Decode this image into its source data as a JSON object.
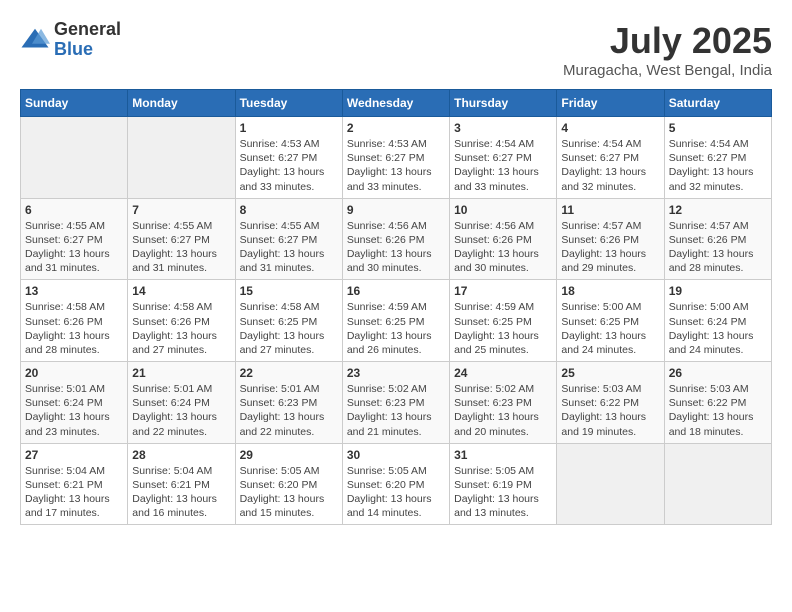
{
  "logo": {
    "general": "General",
    "blue": "Blue"
  },
  "title": {
    "month": "July 2025",
    "location": "Muragacha, West Bengal, India"
  },
  "weekdays": [
    "Sunday",
    "Monday",
    "Tuesday",
    "Wednesday",
    "Thursday",
    "Friday",
    "Saturday"
  ],
  "weeks": [
    [
      {
        "day": "",
        "info": ""
      },
      {
        "day": "",
        "info": ""
      },
      {
        "day": "1",
        "sunrise": "4:53 AM",
        "sunset": "6:27 PM",
        "daylight": "13 hours and 33 minutes."
      },
      {
        "day": "2",
        "sunrise": "4:53 AM",
        "sunset": "6:27 PM",
        "daylight": "13 hours and 33 minutes."
      },
      {
        "day": "3",
        "sunrise": "4:54 AM",
        "sunset": "6:27 PM",
        "daylight": "13 hours and 33 minutes."
      },
      {
        "day": "4",
        "sunrise": "4:54 AM",
        "sunset": "6:27 PM",
        "daylight": "13 hours and 32 minutes."
      },
      {
        "day": "5",
        "sunrise": "4:54 AM",
        "sunset": "6:27 PM",
        "daylight": "13 hours and 32 minutes."
      }
    ],
    [
      {
        "day": "6",
        "sunrise": "4:55 AM",
        "sunset": "6:27 PM",
        "daylight": "13 hours and 31 minutes."
      },
      {
        "day": "7",
        "sunrise": "4:55 AM",
        "sunset": "6:27 PM",
        "daylight": "13 hours and 31 minutes."
      },
      {
        "day": "8",
        "sunrise": "4:55 AM",
        "sunset": "6:27 PM",
        "daylight": "13 hours and 31 minutes."
      },
      {
        "day": "9",
        "sunrise": "4:56 AM",
        "sunset": "6:26 PM",
        "daylight": "13 hours and 30 minutes."
      },
      {
        "day": "10",
        "sunrise": "4:56 AM",
        "sunset": "6:26 PM",
        "daylight": "13 hours and 30 minutes."
      },
      {
        "day": "11",
        "sunrise": "4:57 AM",
        "sunset": "6:26 PM",
        "daylight": "13 hours and 29 minutes."
      },
      {
        "day": "12",
        "sunrise": "4:57 AM",
        "sunset": "6:26 PM",
        "daylight": "13 hours and 28 minutes."
      }
    ],
    [
      {
        "day": "13",
        "sunrise": "4:58 AM",
        "sunset": "6:26 PM",
        "daylight": "13 hours and 28 minutes."
      },
      {
        "day": "14",
        "sunrise": "4:58 AM",
        "sunset": "6:26 PM",
        "daylight": "13 hours and 27 minutes."
      },
      {
        "day": "15",
        "sunrise": "4:58 AM",
        "sunset": "6:25 PM",
        "daylight": "13 hours and 27 minutes."
      },
      {
        "day": "16",
        "sunrise": "4:59 AM",
        "sunset": "6:25 PM",
        "daylight": "13 hours and 26 minutes."
      },
      {
        "day": "17",
        "sunrise": "4:59 AM",
        "sunset": "6:25 PM",
        "daylight": "13 hours and 25 minutes."
      },
      {
        "day": "18",
        "sunrise": "5:00 AM",
        "sunset": "6:25 PM",
        "daylight": "13 hours and 24 minutes."
      },
      {
        "day": "19",
        "sunrise": "5:00 AM",
        "sunset": "6:24 PM",
        "daylight": "13 hours and 24 minutes."
      }
    ],
    [
      {
        "day": "20",
        "sunrise": "5:01 AM",
        "sunset": "6:24 PM",
        "daylight": "13 hours and 23 minutes."
      },
      {
        "day": "21",
        "sunrise": "5:01 AM",
        "sunset": "6:24 PM",
        "daylight": "13 hours and 22 minutes."
      },
      {
        "day": "22",
        "sunrise": "5:01 AM",
        "sunset": "6:23 PM",
        "daylight": "13 hours and 22 minutes."
      },
      {
        "day": "23",
        "sunrise": "5:02 AM",
        "sunset": "6:23 PM",
        "daylight": "13 hours and 21 minutes."
      },
      {
        "day": "24",
        "sunrise": "5:02 AM",
        "sunset": "6:23 PM",
        "daylight": "13 hours and 20 minutes."
      },
      {
        "day": "25",
        "sunrise": "5:03 AM",
        "sunset": "6:22 PM",
        "daylight": "13 hours and 19 minutes."
      },
      {
        "day": "26",
        "sunrise": "5:03 AM",
        "sunset": "6:22 PM",
        "daylight": "13 hours and 18 minutes."
      }
    ],
    [
      {
        "day": "27",
        "sunrise": "5:04 AM",
        "sunset": "6:21 PM",
        "daylight": "13 hours and 17 minutes."
      },
      {
        "day": "28",
        "sunrise": "5:04 AM",
        "sunset": "6:21 PM",
        "daylight": "13 hours and 16 minutes."
      },
      {
        "day": "29",
        "sunrise": "5:05 AM",
        "sunset": "6:20 PM",
        "daylight": "13 hours and 15 minutes."
      },
      {
        "day": "30",
        "sunrise": "5:05 AM",
        "sunset": "6:20 PM",
        "daylight": "13 hours and 14 minutes."
      },
      {
        "day": "31",
        "sunrise": "5:05 AM",
        "sunset": "6:19 PM",
        "daylight": "13 hours and 13 minutes."
      },
      {
        "day": "",
        "info": ""
      },
      {
        "day": "",
        "info": ""
      }
    ]
  ],
  "labels": {
    "sunrise": "Sunrise:",
    "sunset": "Sunset:",
    "daylight": "Daylight:"
  }
}
